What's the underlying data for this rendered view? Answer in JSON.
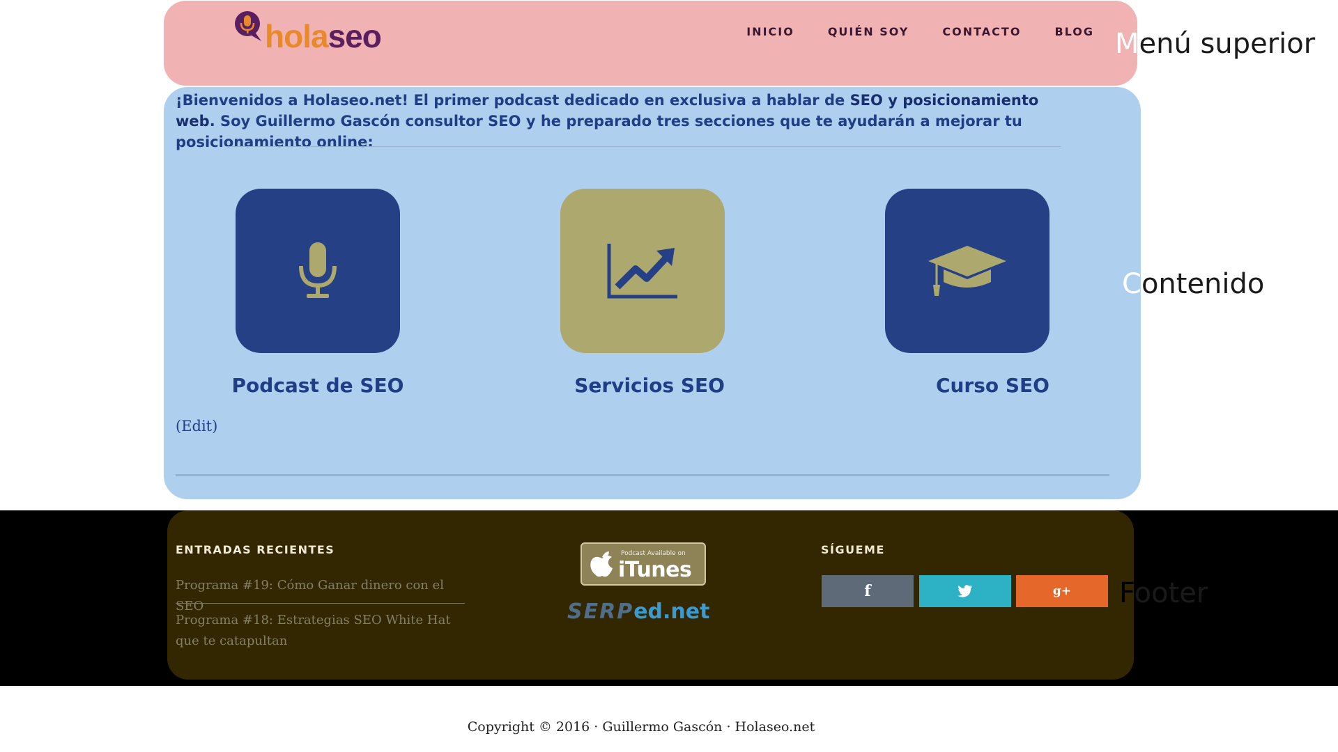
{
  "header": {
    "logo": {
      "part1": "hola",
      "part2": "seo"
    },
    "nav": [
      "INICIO",
      "QUIÉN SOY",
      "CONTACTO",
      "BLOG"
    ]
  },
  "annotations": {
    "menu": {
      "first": "M",
      "rest": "enú superior"
    },
    "content": {
      "first": "C",
      "rest": "ontenido"
    },
    "footer": {
      "first": "F",
      "rest": "ooter"
    }
  },
  "content": {
    "intro": {
      "t1": "¡Bienvenidos a Holaseo.net! El primer podcast dedicado en exclusiva a hablar de ",
      "b1": "SEO y posicionamiento web",
      "t2": ". Soy Guillermo Gascón consultor SEO y he preparado tres secciones que te ayudarán a mejorar tu posicionamiento online:"
    },
    "cards": [
      {
        "title": "Podcast de SEO",
        "icon": "microphone-icon",
        "color": "#254084"
      },
      {
        "title": "Servicios SEO",
        "icon": "trending-chart-icon",
        "color": "#ada86e"
      },
      {
        "title": "Curso SEO",
        "icon": "graduation-cap-icon",
        "color": "#254084"
      }
    ],
    "edit": "(Edit)"
  },
  "footer": {
    "recent_heading": "ENTRADAS RECIENTES",
    "posts": [
      "Programa #19: Cómo Ganar dinero con el SEO",
      "Programa #18: Estrategias SEO White Hat que te catapultan"
    ],
    "itunes": {
      "small": "Podcast Available on",
      "big": "iTunes"
    },
    "serped": {
      "a": "SERP",
      "b": "ed.net"
    },
    "follow_heading": "SÍGUEME",
    "social": [
      {
        "label": "f",
        "icon": "facebook-icon",
        "color": "#5f6a78"
      },
      {
        "label": "t",
        "icon": "twitter-icon",
        "color": "#2db2c5"
      },
      {
        "label": "g+",
        "icon": "google-plus-icon",
        "color": "#e5682a"
      }
    ]
  },
  "copyright": "Copyright © 2016 · Guillermo Gascón · Holaseo.net"
}
